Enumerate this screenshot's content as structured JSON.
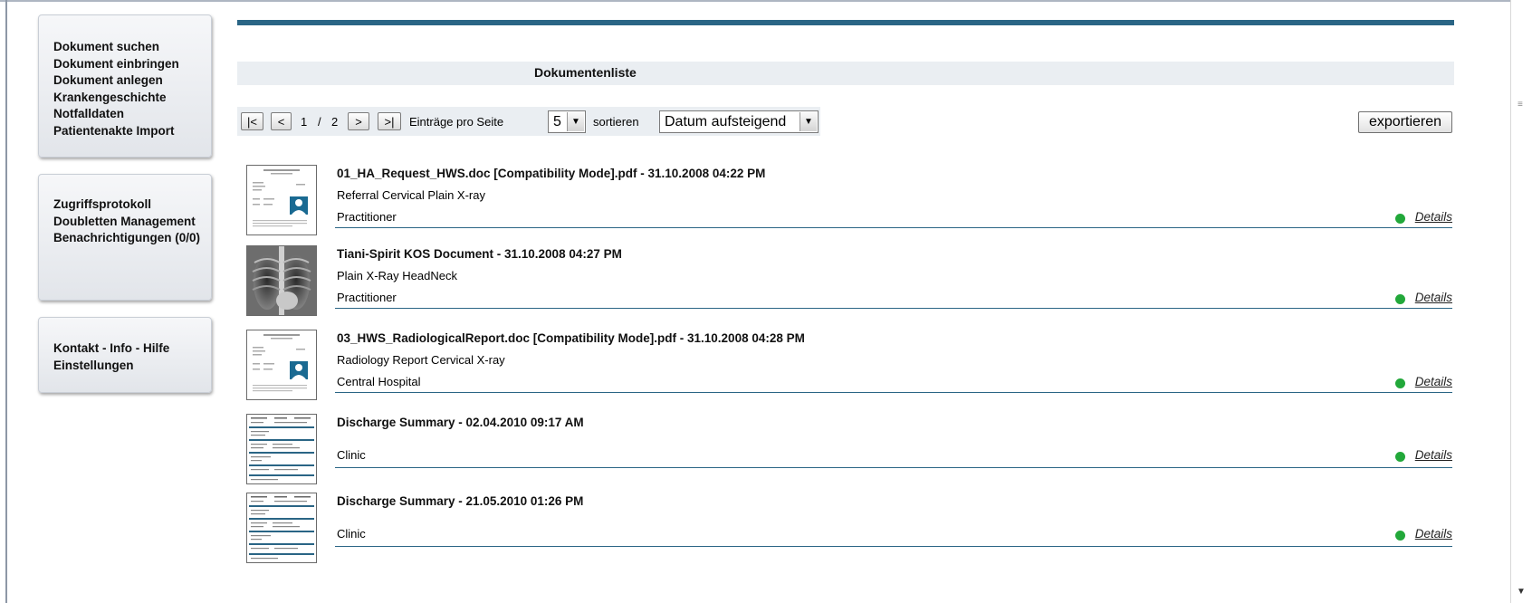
{
  "nav": {
    "group1": [
      "Dokument suchen",
      "Dokument einbringen",
      "Dokument anlegen",
      "Krankengeschichte",
      "Notfalldaten",
      "Patientenakte Import"
    ],
    "group2": [
      "Zugriffsprotokoll",
      "Doubletten Management",
      "Benachrichtigungen (0/0)"
    ],
    "group3": [
      "Kontakt - Info - Hilfe",
      "Einstellungen"
    ]
  },
  "list_title": "Dokumentenliste",
  "pager": {
    "first": "|<",
    "prev": "<",
    "page_current": "1",
    "separator": "/",
    "page_total": "2",
    "next": ">",
    "last": ">|",
    "per_page_label": "Einträge pro Seite",
    "per_page_value": "5",
    "sort_label": "sortieren",
    "sort_value": "Datum aufsteigend"
  },
  "export_label": "exportieren",
  "documents": [
    {
      "title": "01_HA_Request_HWS.doc [Compatibility Mode].pdf - 31.10.2008 04:22 PM",
      "description": "Referral Cervical Plain X-ray",
      "author": "Practitioner",
      "details": "Details",
      "thumbnail": "document-with-photo"
    },
    {
      "title": "Tiani-Spirit KOS Document - 31.10.2008 04:27 PM",
      "description": "Plain X-Ray HeadNeck",
      "author": "Practitioner",
      "details": "Details",
      "thumbnail": "chest-xray"
    },
    {
      "title": "03_HWS_RadiologicalReport.doc [Compatibility Mode].pdf - 31.10.2008 04:28 PM",
      "description": "Radiology Report Cervical X-ray",
      "author": "Central Hospital",
      "details": "Details",
      "thumbnail": "document-with-photo"
    },
    {
      "title": "Discharge Summary - 02.04.2010 09:17 AM",
      "description": "",
      "author": "Clinic",
      "details": "Details",
      "thumbnail": "form-document"
    },
    {
      "title": "Discharge Summary - 21.05.2010 01:26 PM",
      "description": "",
      "author": "Clinic",
      "details": "Details",
      "thumbnail": "form-document"
    }
  ],
  "colors": {
    "accent": "#2a6585",
    "status_ok": "#22a83a",
    "header_bg": "#eaeef2"
  }
}
